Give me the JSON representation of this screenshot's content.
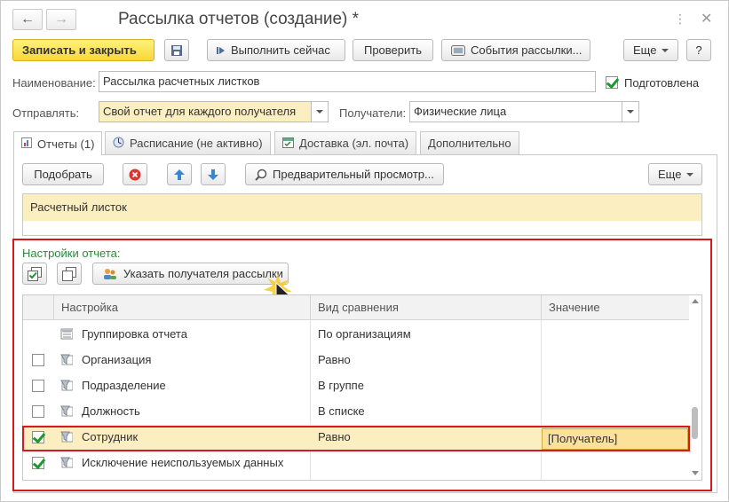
{
  "window": {
    "title": "Рассылка отчетов (создание) *",
    "back_icon": "arrow-left",
    "forward_icon": "arrow-right"
  },
  "toolbar": {
    "save_close": "Записать и закрыть",
    "run_now": "Выполнить сейчас",
    "check": "Проверить",
    "events": "События рассылки...",
    "more": "Еще",
    "help": "?"
  },
  "form": {
    "name_label": "Наименование:",
    "name_value": "Рассылка расчетных листков",
    "prepared_label": "Подготовлена",
    "prepared_checked": true,
    "send_label": "Отправлять:",
    "send_value": "Свой отчет для каждого получателя",
    "recipients_label": "Получатели:",
    "recipients_value": "Физические лица"
  },
  "tabs": [
    {
      "label": "Отчеты (1)",
      "active": true
    },
    {
      "label": "Расписание (не активно)",
      "active": false
    },
    {
      "label": "Доставка (эл. почта)",
      "active": false
    },
    {
      "label": "Дополнительно",
      "active": false
    }
  ],
  "reports_toolbar": {
    "pick": "Подобрать",
    "preview": "Предварительный просмотр...",
    "more": "Еще"
  },
  "reports": [
    "Расчетный листок"
  ],
  "settings": {
    "label": "Настройки отчета:",
    "specify_recipient": "Указать получателя рассылки",
    "columns": [
      "Настройка",
      "Вид сравнения",
      "Значение"
    ],
    "rows": [
      {
        "checkbox": false,
        "show_checkbox": false,
        "name": "Группировка отчета",
        "comparison": "По организациям",
        "value": ""
      },
      {
        "checkbox": false,
        "show_checkbox": true,
        "name": "Организация",
        "comparison": "Равно",
        "value": ""
      },
      {
        "checkbox": false,
        "show_checkbox": true,
        "name": "Подразделение",
        "comparison": "В группе",
        "value": ""
      },
      {
        "checkbox": false,
        "show_checkbox": true,
        "name": "Должность",
        "comparison": "В списке",
        "value": ""
      },
      {
        "checkbox": true,
        "show_checkbox": true,
        "name": "Сотрудник",
        "comparison": "Равно",
        "value": "[Получатель]"
      },
      {
        "checkbox": true,
        "show_checkbox": true,
        "name": "Исключение неиспользуемых данных",
        "comparison": "",
        "value": ""
      }
    ]
  },
  "colors": {
    "highlight": "#d6191f",
    "selection": "#fbeec0",
    "primary_button": "#f6d83a",
    "settings_label": "#2a8a3a"
  }
}
